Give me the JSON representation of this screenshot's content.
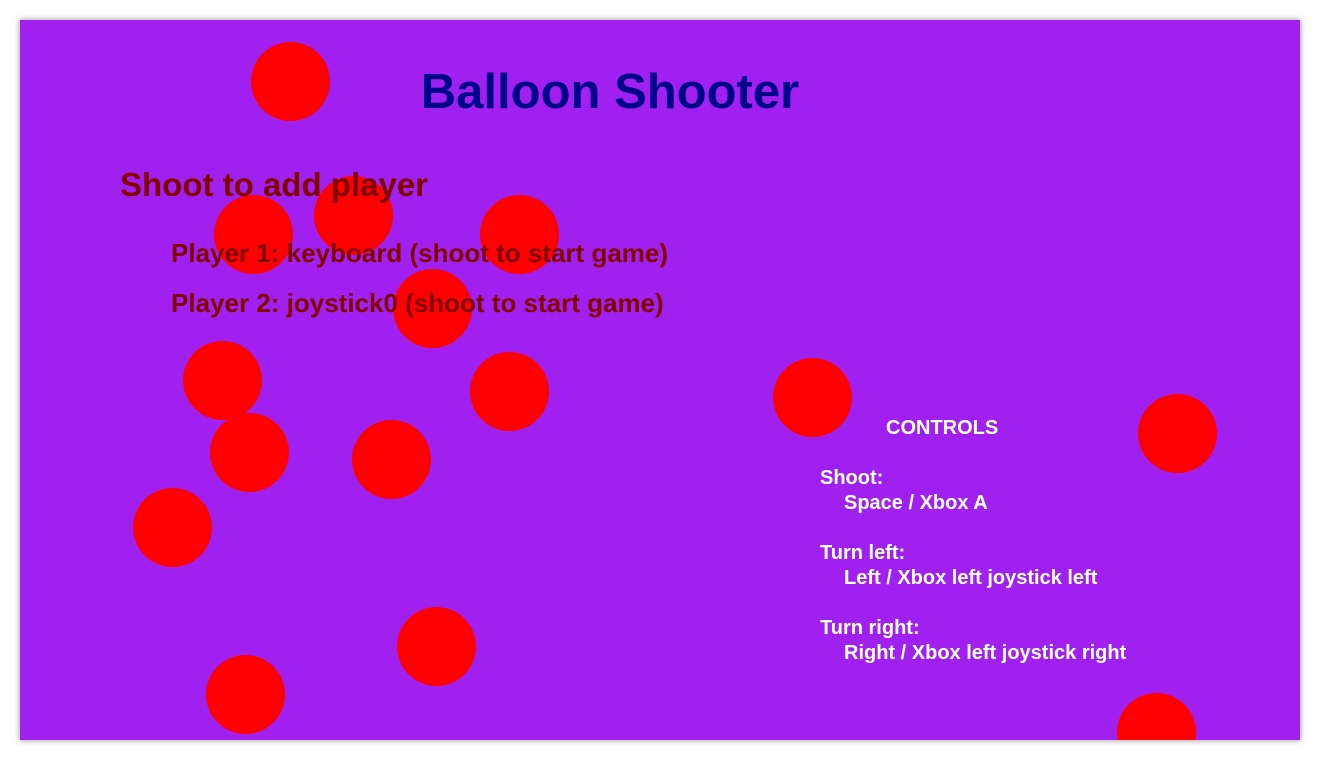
{
  "game": {
    "title": "Balloon Shooter",
    "background_color": "#a020f0",
    "balloon_color": "#ff0000",
    "balloon_count": 16
  },
  "lobby": {
    "heading": "Shoot to add player",
    "players": [
      "Player 1: keyboard (shoot to start game)",
      "Player 2: joystick0 (shoot to start game)"
    ]
  },
  "controls": {
    "heading": "CONTROLS",
    "items": [
      {
        "action": "Shoot:",
        "keys": "Space / Xbox A"
      },
      {
        "action": "Turn left:",
        "keys": "Left / Xbox left joystick left"
      },
      {
        "action": "Turn right:",
        "keys": "Right / Xbox left joystick right"
      }
    ]
  }
}
